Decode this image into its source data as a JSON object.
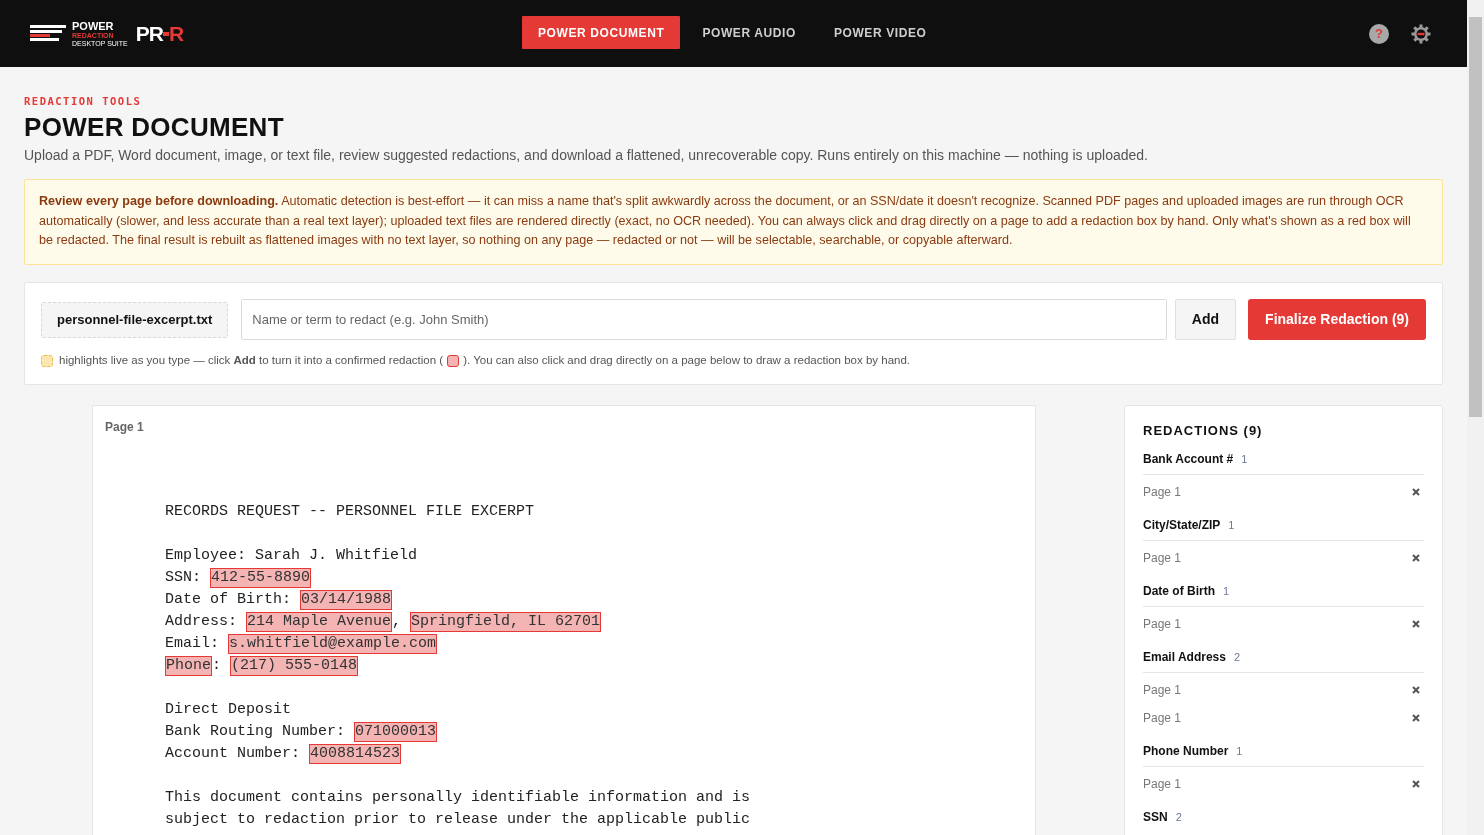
{
  "logo": {
    "word": "POWER",
    "sub": "REDACTION",
    "tagline": "DESKTOP SUITE",
    "mark": "PR",
    "mark_accent": "R"
  },
  "nav_tabs": [
    {
      "label": "POWER DOCUMENT",
      "selected": true
    },
    {
      "label": "POWER AUDIO",
      "selected": false
    },
    {
      "label": "POWER VIDEO",
      "selected": false
    }
  ],
  "help_button": {
    "label": "?"
  },
  "eyebrow": "REDACTION TOOLS",
  "title": "POWER DOCUMENT",
  "description": "Upload a PDF, Word document, image, or text file, review suggested redactions, and download a flattened, unrecoverable copy. Runs entirely on this machine — nothing is uploaded.",
  "warning": "**Review every page before downloading.** Automatic detection is best-effort — it can miss a name that's split awkwardly across the document, or an SSN/date it doesn't recognize. Scanned PDF pages and uploaded images are run through OCR automatically (slower, and less accurate than a real text layer); uploaded text files are rendered directly (exact, no OCR needed). You can always click and drag directly on a page to add a redaction box by hand. Only what's shown as a red box will be redacted. The final result is rebuilt as flattened images with no text layer, so nothing on any page — redacted or not — will be selectable, searchable, or copyable afterward.",
  "toolbar": {
    "file_name": "personnel-file-excerpt.txt",
    "term_placeholder": "Name or term to redact (e.g. John Smith)",
    "add_button": "Add",
    "finalize_button": "Finalize Redaction (9)",
    "hint_before": "highlights live as you type — click **Add** to turn it into a confirmed redaction (",
    "hint_after": "). You can also click and drag directly on a page below to draw a redaction box by hand."
  },
  "document": {
    "page_label": "Page 1",
    "lines": [
      {
        "segments": [
          {
            "text": "RECORDS REQUEST -- PERSONNEL FILE EXCERPT",
            "redacted": false
          }
        ]
      },
      {
        "kind": "blank"
      },
      {
        "segments": [
          {
            "text": "Employee: Sarah J. Whitfield",
            "redacted": false
          }
        ]
      },
      {
        "segments": [
          {
            "text": "SSN: ",
            "redacted": false
          },
          {
            "text": "412-55-8890",
            "redacted": true
          }
        ]
      },
      {
        "segments": [
          {
            "text": "Date of Birth: ",
            "redacted": false
          },
          {
            "text": "03/14/1988",
            "redacted": true
          }
        ]
      },
      {
        "segments": [
          {
            "text": "Address: ",
            "redacted": false
          },
          {
            "text": "214 Maple Avenue",
            "redacted": true
          },
          {
            "text": ", ",
            "redacted": false
          },
          {
            "text": "Springfield, IL 62701",
            "redacted": true
          }
        ]
      },
      {
        "segments": [
          {
            "text": "Email: ",
            "redacted": false
          },
          {
            "text": "s.whitfield@example.com",
            "redacted": true
          }
        ]
      },
      {
        "segments": [
          {
            "text": "Phone",
            "redacted": true
          },
          {
            "text": ": ",
            "redacted": false
          },
          {
            "text": "(217) 555-0148",
            "redacted": true
          }
        ]
      },
      {
        "kind": "blank"
      },
      {
        "segments": [
          {
            "text": "Direct Deposit",
            "redacted": false
          }
        ]
      },
      {
        "segments": [
          {
            "text": "Bank Routing Number: ",
            "redacted": false
          },
          {
            "text": "071000013",
            "redacted": true
          }
        ]
      },
      {
        "segments": [
          {
            "text": "Account Number: ",
            "redacted": false
          },
          {
            "text": "4008814523",
            "redacted": true
          }
        ]
      },
      {
        "kind": "blank"
      },
      {
        "segments": [
          {
            "text": "This document contains personally identifiable information and is",
            "redacted": false
          }
        ]
      },
      {
        "segments": [
          {
            "text": "subject to redaction prior to release under the applicable public",
            "redacted": false
          }
        ]
      }
    ]
  },
  "redactions": {
    "title": "REDACTIONS (9)",
    "groups": [
      {
        "label": "Bank Account #",
        "count": "1",
        "items": [
          "Page 1"
        ]
      },
      {
        "label": "City/State/ZIP",
        "count": "1",
        "items": [
          "Page 1"
        ]
      },
      {
        "label": "Date of Birth",
        "count": "1",
        "items": [
          "Page 1"
        ]
      },
      {
        "label": "Email Address",
        "count": "2",
        "items": [
          "Page 1",
          "Page 1"
        ]
      },
      {
        "label": "Phone Number",
        "count": "1",
        "items": [
          "Page 1"
        ]
      },
      {
        "label": "SSN",
        "count": "2"
      }
    ]
  }
}
